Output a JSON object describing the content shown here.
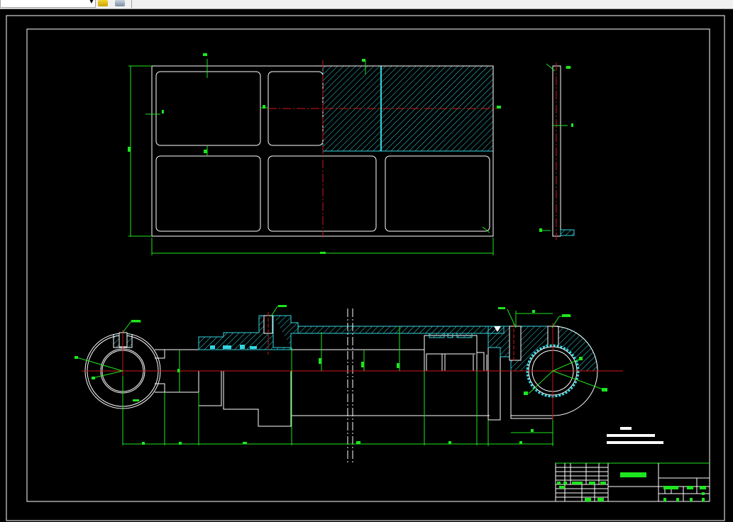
{
  "app": {
    "layer_combo_value": "",
    "toolbar_icons": [
      "layer-states-icon",
      "layer-manager-icon"
    ]
  },
  "colors": {
    "background": "#000000",
    "geometry": "#ffffff",
    "dimension": "#1ee61e",
    "centerline": "#d01818",
    "hatch": "#33d6e0",
    "toolbar": "#f0f0f0"
  },
  "drawing": {
    "views": [
      "plate-front-view",
      "plate-side-view",
      "cylinder-section-view"
    ],
    "title_block_present": true
  }
}
